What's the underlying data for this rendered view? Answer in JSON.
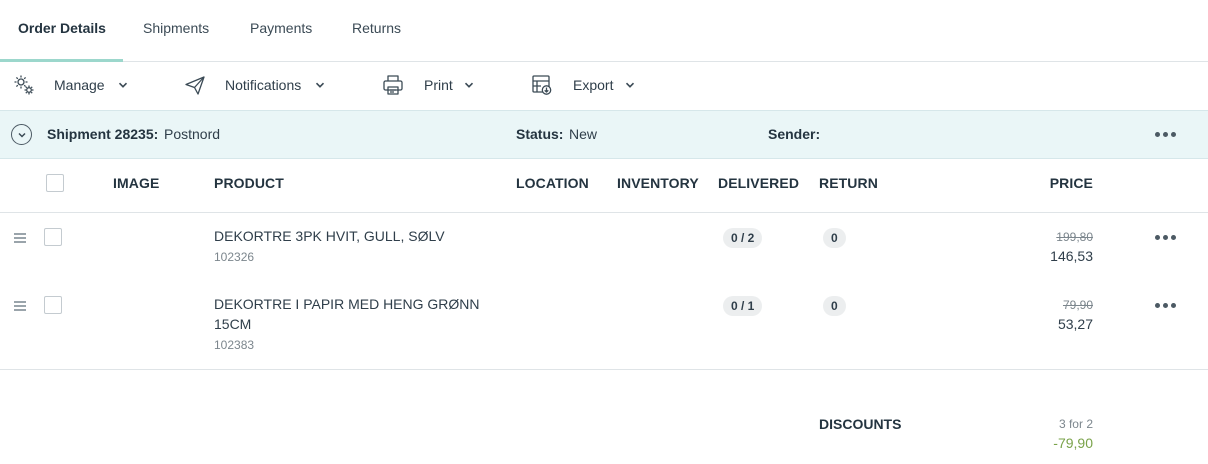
{
  "tabs": [
    {
      "label": "Order Details",
      "active": true
    },
    {
      "label": "Shipments",
      "active": false
    },
    {
      "label": "Payments",
      "active": false
    },
    {
      "label": "Returns",
      "active": false
    }
  ],
  "toolbar": {
    "manage": {
      "label": "Manage",
      "icon": "gears-icon"
    },
    "notifications": {
      "label": "Notifications",
      "icon": "paper-plane-icon"
    },
    "print": {
      "label": "Print",
      "icon": "printer-icon"
    },
    "export": {
      "label": "Export",
      "icon": "export-icon"
    }
  },
  "shipment": {
    "title": "Shipment 28235:",
    "carrier": "Postnord",
    "status_label": "Status:",
    "status_value": "New",
    "sender_label": "Sender:",
    "sender_value": ""
  },
  "columns": {
    "image": "IMAGE",
    "product": "PRODUCT",
    "location": "LOCATION",
    "inventory": "INVENTORY",
    "delivered": "DELIVERED",
    "return": "RETURN",
    "price": "PRICE"
  },
  "rows": [
    {
      "name": "DEKORTRE 3PK HVIT, GULL, SØLV",
      "sku": "102326",
      "delivered": "0 / 2",
      "return": "0",
      "price_original": "199,80",
      "price": "146,53"
    },
    {
      "name": "DEKORTRE I PAPIR MED HENG GRØNN 15CM",
      "sku": "102383",
      "delivered": "0 / 1",
      "return": "0",
      "price_original": "79,90",
      "price": "53,27"
    }
  ],
  "discounts": {
    "label": "DISCOUNTS",
    "name": "3 for 2",
    "value": "-79,90"
  },
  "colors": {
    "accent": "#9cd7cc",
    "shipment_band": "#eaf6f7",
    "discount": "#7aa34a"
  }
}
